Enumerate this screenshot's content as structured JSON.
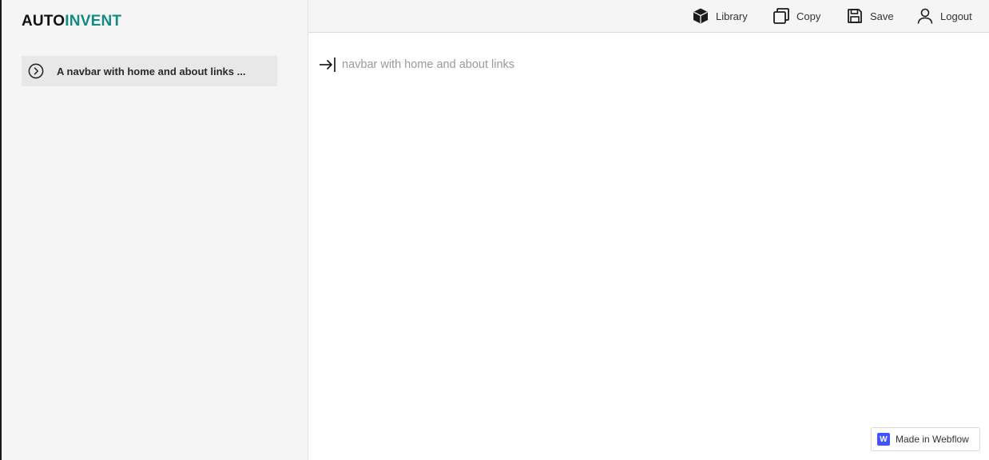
{
  "logo": {
    "part1": "AUTO",
    "part2": "INVENT"
  },
  "sidebar": {
    "items": [
      {
        "label": "A navbar with home and about links ...",
        "icon": "chevron-right-circle-icon"
      }
    ]
  },
  "topbar": {
    "library_label": "Library",
    "copy_label": "Copy",
    "save_label": "Save",
    "logout_label": "Logout"
  },
  "prompt": {
    "value": "",
    "placeholder": "navbar with home and about links"
  },
  "badge": {
    "logo_letter": "W",
    "label": "Made in Webflow"
  },
  "colors": {
    "accent": "#138a82",
    "sidebar_bg": "#f5f5f5",
    "webflow_blue": "#4353ff"
  }
}
